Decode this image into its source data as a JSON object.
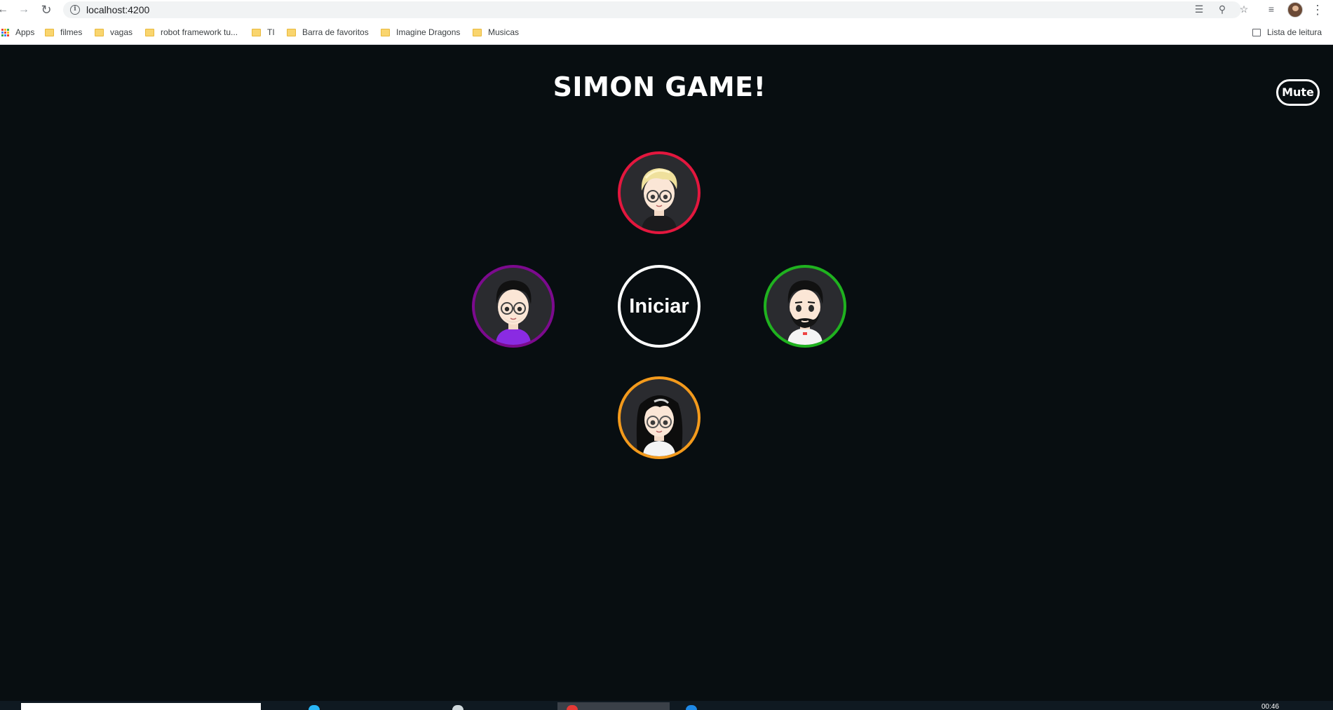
{
  "browser": {
    "url": "localhost:4200",
    "bookmarks": [
      {
        "label": "Apps",
        "icon": "apps-grid-icon"
      },
      {
        "label": "filmes",
        "icon": "folder-icon"
      },
      {
        "label": "vagas",
        "icon": "folder-icon"
      },
      {
        "label": "robot framework tu...",
        "icon": "folder-icon"
      },
      {
        "label": "TI",
        "icon": "folder-icon"
      },
      {
        "label": "Barra de favoritos",
        "icon": "folder-icon"
      },
      {
        "label": "Imagine Dragons",
        "icon": "folder-icon"
      },
      {
        "label": "Musicas",
        "icon": "folder-icon"
      }
    ],
    "reading_list": "Lista de leitura"
  },
  "game": {
    "title": "SIMON GAME!",
    "mute_label": "Mute",
    "start_label": "Iniciar",
    "pads": [
      {
        "name": "top",
        "color": "#e3173e",
        "avatar": "blonde-glasses-avatar"
      },
      {
        "name": "left",
        "color": "#7c0a8e",
        "avatar": "dark-hair-glasses-avatar"
      },
      {
        "name": "right",
        "color": "#1fb21f",
        "avatar": "bearded-avatar"
      },
      {
        "name": "bottom",
        "color": "#f39a1c",
        "avatar": "long-hair-glasses-avatar"
      }
    ]
  },
  "taskbar": {
    "clock": "00:46"
  }
}
